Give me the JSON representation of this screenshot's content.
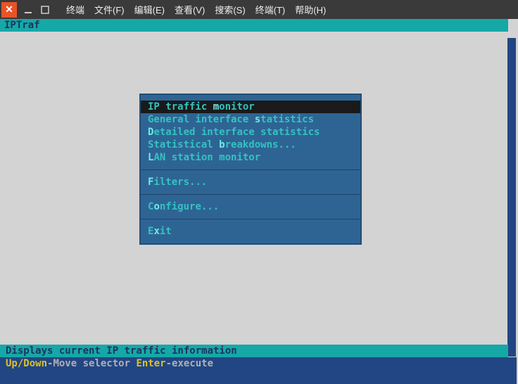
{
  "window": {
    "menus": [
      "终端",
      "文件(F)",
      "编辑(E)",
      "查看(V)",
      "搜索(S)",
      "终端(T)",
      "帮助(H)"
    ]
  },
  "app": {
    "title": "IPTraf"
  },
  "menu": {
    "items": [
      {
        "pre": "IP traffic ",
        "hot": "m",
        "post": "onitor",
        "selected": true
      },
      {
        "pre": "General interface ",
        "hot": "s",
        "post": "tatistics",
        "selected": false
      },
      {
        "pre": "",
        "hot": "D",
        "post": "etailed interface statistics",
        "selected": false
      },
      {
        "pre": "Statistical ",
        "hot": "b",
        "post": "reakdowns...",
        "selected": false
      },
      {
        "pre": "",
        "hot": "L",
        "post": "AN station monitor",
        "selected": false
      }
    ],
    "filters": {
      "pre": "",
      "hot": "F",
      "post": "ilters..."
    },
    "configure": {
      "pre": "C",
      "hot": "o",
      "post": "nfigure..."
    },
    "exit": {
      "pre": "E",
      "hot": "x",
      "post": "it"
    }
  },
  "status": {
    "description": "Displays current IP traffic information",
    "help_key1": "Up/Down",
    "help_txt1": "-Move selector  ",
    "help_key2": "Enter",
    "help_txt2": "-execute"
  }
}
